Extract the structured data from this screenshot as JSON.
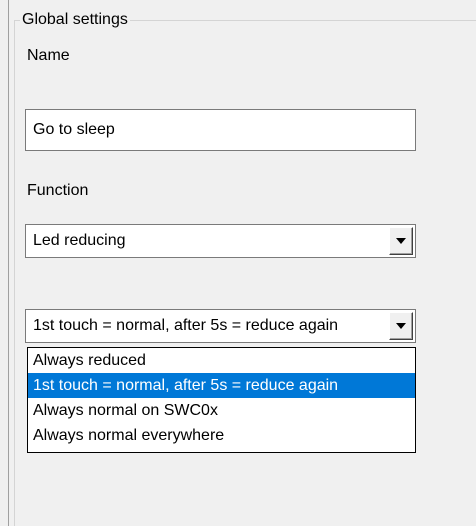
{
  "groupbox": {
    "title": "Global settings"
  },
  "name_section": {
    "label": "Name",
    "value": "Go to sleep"
  },
  "function_section": {
    "label": "Function",
    "selected": "Led reducing"
  },
  "mode_section": {
    "selected": "1st touch = normal, after 5s = reduce again",
    "options": [
      "Always reduced",
      "1st touch = normal, after 5s = reduce again",
      "Always normal on SWC0x",
      "Always normal everywhere"
    ],
    "highlighted_index": 1
  },
  "colors": {
    "highlight": "#0078d7",
    "background": "#f0f0f0"
  },
  "icons": {
    "combo_arrow": "chevron-down-icon"
  }
}
